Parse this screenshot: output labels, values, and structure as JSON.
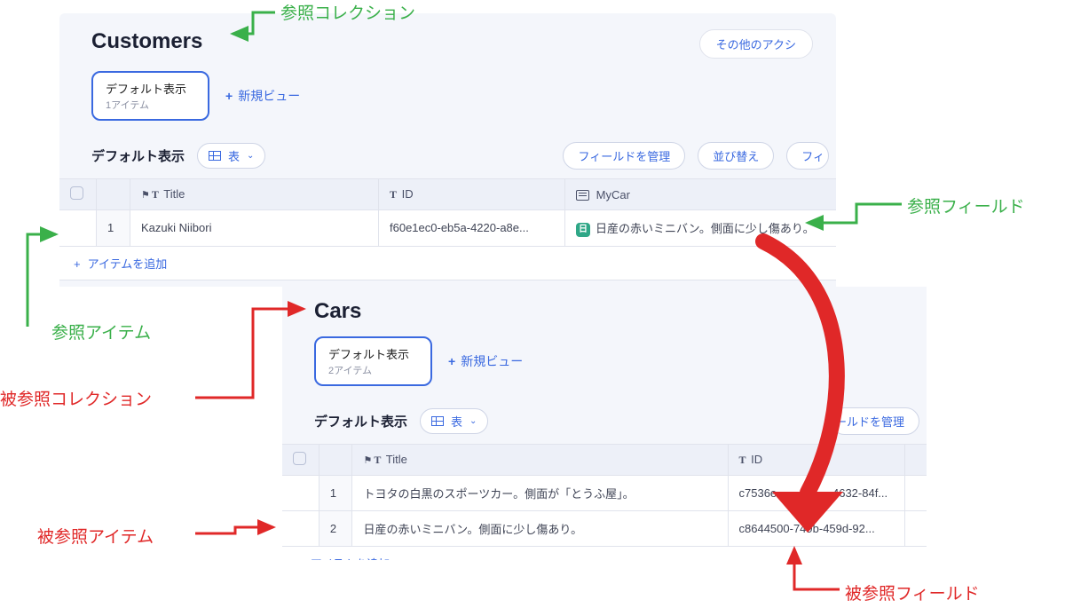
{
  "annotations": {
    "ref_collection": "参照コレクション",
    "ref_item": "参照アイテム",
    "ref_field": "参照フィールド",
    "target_collection": "被参照コレクション",
    "target_item": "被参照アイテム",
    "target_field": "被参照フィールド"
  },
  "common": {
    "other_actions": "その他のアクシ",
    "default_view": "デフォルト表示",
    "new_view": "新規ビュー",
    "table_label": "表",
    "manage_fields": "フィールドを管理",
    "sort": "並び替え",
    "filter_short": "フィ",
    "fields_partial": "ールドを管理",
    "add_item": "アイテムを追加",
    "plus": "+"
  },
  "customers": {
    "title": "Customers",
    "item_count": "1アイテム",
    "columns": {
      "title": "Title",
      "id": "ID",
      "mycar": "MyCar"
    },
    "rows": [
      {
        "idx": "1",
        "title": "Kazuki Niibori",
        "id": "f60e1ec0-eb5a-4220-a8e...",
        "mycar": "日産の赤いミニバン。側面に少し傷あり。"
      }
    ]
  },
  "cars": {
    "title": "Cars",
    "item_count": "2アイテム",
    "columns": {
      "title": "Title",
      "id": "ID"
    },
    "rows": [
      {
        "idx": "1",
        "title": "トヨタの白黒のスポーツカー。側面が「とうふ屋」。",
        "id_partial_left": "c7536e",
        "id_partial_right": "-4632-84f..."
      },
      {
        "idx": "2",
        "title": "日産の赤いミニバン。側面に少し傷あり。",
        "id": "c8644500-749b-459d-92..."
      }
    ]
  }
}
